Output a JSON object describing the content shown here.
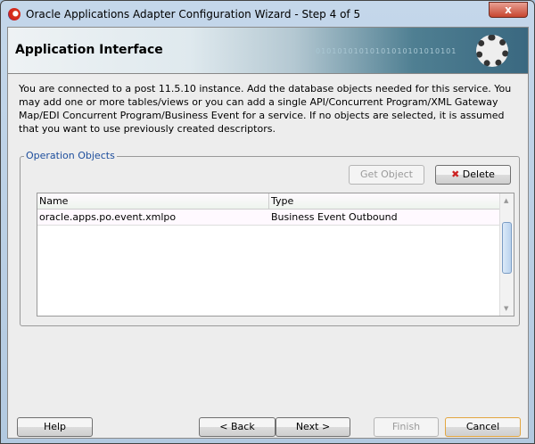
{
  "window": {
    "title": "Oracle Applications Adapter Configuration Wizard - Step 4 of 5",
    "close_label": "x"
  },
  "header": {
    "title": "Application Interface",
    "binary": "01010101010101010101010101"
  },
  "description": "You are connected to a post 11.5.10 instance. Add the database objects needed for this service. You may add one or more tables/views or you can add a single API/Concurrent Program/XML Gateway Map/EDI Concurrent Program/Business Event for a service. If no objects are selected, it is assumed that you want to use previously created descriptors.",
  "group": {
    "label": "Operation Objects",
    "get_object": "Get Object",
    "delete": "Delete"
  },
  "table": {
    "columns": [
      "Name",
      "Type"
    ],
    "rows": [
      {
        "name": "oracle.apps.po.event.xmlpo",
        "type": "Business Event Outbound"
      }
    ]
  },
  "footer": {
    "help": "Help",
    "back": "< Back",
    "next": "Next >",
    "finish": "Finish",
    "cancel": "Cancel"
  }
}
